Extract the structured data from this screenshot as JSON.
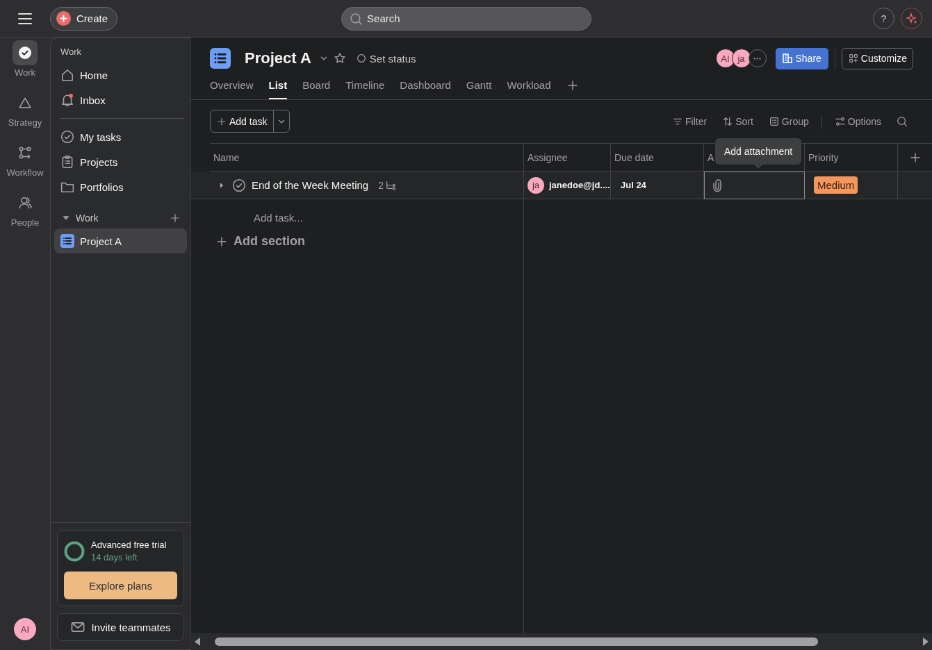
{
  "topbar": {
    "create_label": "Create",
    "search_placeholder": "Search",
    "help_label": "?"
  },
  "rail": [
    {
      "label": "Work",
      "selected": true
    },
    {
      "label": "Strategy",
      "selected": false
    },
    {
      "label": "Workflow",
      "selected": false
    },
    {
      "label": "People",
      "selected": false
    }
  ],
  "rail_avatar": "AI",
  "sidebar": {
    "heading": "Work",
    "top_items": [
      {
        "label": "Home",
        "badge": false
      },
      {
        "label": "Inbox",
        "badge": true
      }
    ],
    "items": [
      {
        "label": "My tasks"
      },
      {
        "label": "Projects"
      },
      {
        "label": "Portfolios"
      }
    ],
    "section": {
      "label": "Work",
      "expanded": true,
      "items": [
        {
          "label": "Project A",
          "selected": true
        }
      ]
    },
    "trial": {
      "title": "Advanced free trial",
      "subtitle": "14 days left",
      "button": "Explore plans"
    },
    "invite": "Invite teammates"
  },
  "project": {
    "title": "Project A",
    "status": "Set status",
    "members": [
      "AI",
      "ja"
    ],
    "share": "Share",
    "customize": "Customize",
    "tabs": [
      {
        "label": "Overview",
        "selected": false
      },
      {
        "label": "List",
        "selected": true
      },
      {
        "label": "Board",
        "selected": false
      },
      {
        "label": "Timeline",
        "selected": false
      },
      {
        "label": "Dashboard",
        "selected": false
      },
      {
        "label": "Gantt",
        "selected": false
      },
      {
        "label": "Workload",
        "selected": false
      }
    ],
    "add_task": "Add task",
    "toolbar": [
      {
        "label": "Filter"
      },
      {
        "label": "Sort"
      },
      {
        "label": "Group"
      },
      {
        "label": "Options"
      }
    ],
    "columns": [
      "Name",
      "Assignee",
      "Due date",
      "A",
      "Priority"
    ],
    "rows": [
      {
        "name": "End of the Week Meeting",
        "subtask_count": "2",
        "completed": false,
        "assignee_initials": "ja",
        "assignee": "janedoe@jd....",
        "due": "Jul 24",
        "priority": {
          "label": "Medium",
          "color": "#f3975f"
        }
      }
    ],
    "add_task_row": "Add task...",
    "add_section": "Add section",
    "tooltip": "Add attachment"
  }
}
